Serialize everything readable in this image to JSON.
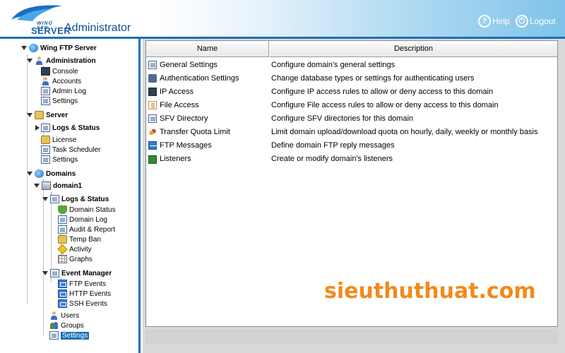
{
  "header": {
    "logo_wing": "WING FTP",
    "logo_server": "SERVER",
    "title": "Administrator",
    "help_label": "Help",
    "logout_label": "Logout"
  },
  "sidebar": {
    "root": "Wing FTP Server",
    "administration": {
      "label": "Administration",
      "items": [
        "Console",
        "Accounts",
        "Admin Log",
        "Settings"
      ]
    },
    "server": {
      "label": "Server",
      "logs_status": "Logs & Status",
      "items": [
        "License",
        "Task Scheduler",
        "Settings"
      ]
    },
    "domains": {
      "label": "Domains",
      "domain": "domain1",
      "logs_status": {
        "label": "Logs & Status",
        "items": [
          "Domain Status",
          "Domain Log",
          "Audit & Report",
          "Temp Ban",
          "Activity",
          "Graphs"
        ]
      },
      "event_manager": {
        "label": "Event Manager",
        "items": [
          "FTP Events",
          "HTTP Events",
          "SSH Events"
        ]
      },
      "users": "Users",
      "groups": "Groups",
      "settings": "Settings"
    }
  },
  "table": {
    "columns": [
      "Name",
      "Description"
    ],
    "rows": [
      {
        "name": "General Settings",
        "desc": "Configure domain's general settings",
        "icon": "settings-page-icon"
      },
      {
        "name": "Authentication Settings",
        "desc": "Change database types or settings for authenticating users",
        "icon": "authentication-icon"
      },
      {
        "name": "IP Access",
        "desc": "Configure IP access rules to allow or deny access to this domain",
        "icon": "ip-access-icon"
      },
      {
        "name": "File Access",
        "desc": "Configure File access rules to allow or deny access to this domain",
        "icon": "file-access-icon"
      },
      {
        "name": "SFV Directory",
        "desc": "Configure SFV directories for this domain",
        "icon": "sfv-directory-icon"
      },
      {
        "name": "Transfer Quota Limit",
        "desc": "Limit domain upload/download quota on hourly, daily, weekly or monthly basis",
        "icon": "quota-icon"
      },
      {
        "name": "FTP Messages",
        "desc": "Define domain FTP reply messages",
        "icon": "ftp-messages-icon"
      },
      {
        "name": "Listeners",
        "desc": "Create or modify domain's listeners",
        "icon": "listeners-icon"
      }
    ]
  },
  "watermark": "sieuthuthuat.com",
  "colors": {
    "accent": "#1d6fb8",
    "watermark": "#f28a1c"
  }
}
